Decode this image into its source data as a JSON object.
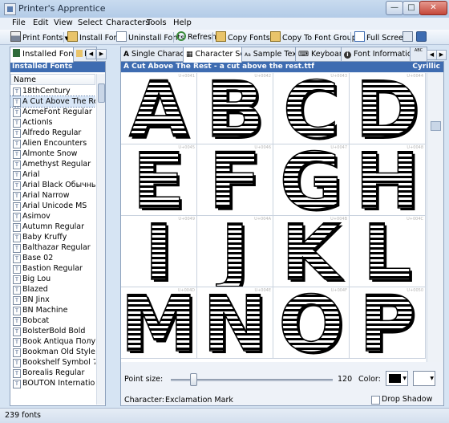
{
  "window": {
    "title": "Printer's Apprentice"
  },
  "menu": [
    "File",
    "Edit",
    "View",
    "Select",
    "Characters",
    "Tools",
    "Help"
  ],
  "toolbar": {
    "print_fonts": "Print Fonts",
    "install_fonts": "Install Fonts",
    "uninstall_fonts": "Uninstall Fonts",
    "refresh": "Refresh",
    "copy_fonts": "Copy Fonts",
    "copy_to_group": "Copy To Font Group",
    "full_screen": "Full Screen"
  },
  "left": {
    "tab_installed": "Installed Fonts",
    "tab_second": "F",
    "header": "Installed Fonts",
    "column": "Name",
    "fonts": [
      "18thCentury",
      "A Cut Above The Rest",
      "AcmeFont Regular",
      "ActionIs",
      "Alfredo Regular",
      "Alien Encounters",
      "Almonte Snow",
      "Amethyst Regular",
      "Arial",
      "Arial Black Обычный",
      "Arial Narrow",
      "Arial Unicode MS",
      "Asimov",
      "Autumn Regular",
      "Baby Kruffy",
      "Balthazar Regular",
      "Base 02",
      "Bastion Regular",
      "Big Lou",
      "Blazed",
      "BN Jinx",
      "BN Machine",
      "Bobcat",
      "BolsterBold Bold",
      "Book Antiqua Полужи...",
      "Bookman Old Style",
      "Bookshelf Symbol 7",
      "Borealis Regular",
      "BOUTON Internation..."
    ],
    "selected_index": 1
  },
  "main": {
    "tabs": [
      "Single Character",
      "Character Set",
      "Sample Text",
      "Keyboard",
      "Font Information"
    ],
    "tab_icons": [
      "A",
      "▦",
      "Aa",
      "⌨",
      "i",
      "ABC"
    ],
    "active_tab": 1,
    "header_title": "A Cut Above The Rest - a cut above the rest.ttf",
    "header_script": "Cyrillic",
    "letters": [
      "A",
      "B",
      "C",
      "D",
      "E",
      "F",
      "G",
      "H",
      "I",
      "J",
      "K",
      "L",
      "M",
      "N",
      "O",
      "P"
    ],
    "codes": [
      "U+0041",
      "U+0042",
      "U+0043",
      "U+0044",
      "U+0045",
      "U+0046",
      "U+0047",
      "U+0048",
      "U+0049",
      "U+004A",
      "U+004B",
      "U+004C",
      "U+004D",
      "U+004E",
      "U+004F",
      "U+0050"
    ],
    "point_size_label": "Point size:",
    "point_size_value": "120",
    "point_size_fraction": 0.14,
    "color_label": "Color:",
    "colors": {
      "foreground": "#000000",
      "background": "#ffffff"
    },
    "character_label": "Character:",
    "character_value": "Exclamation Mark",
    "drop_shadow_label": "Drop Shadow",
    "drop_shadow_checked": false
  },
  "status": {
    "text": "239 fonts"
  }
}
